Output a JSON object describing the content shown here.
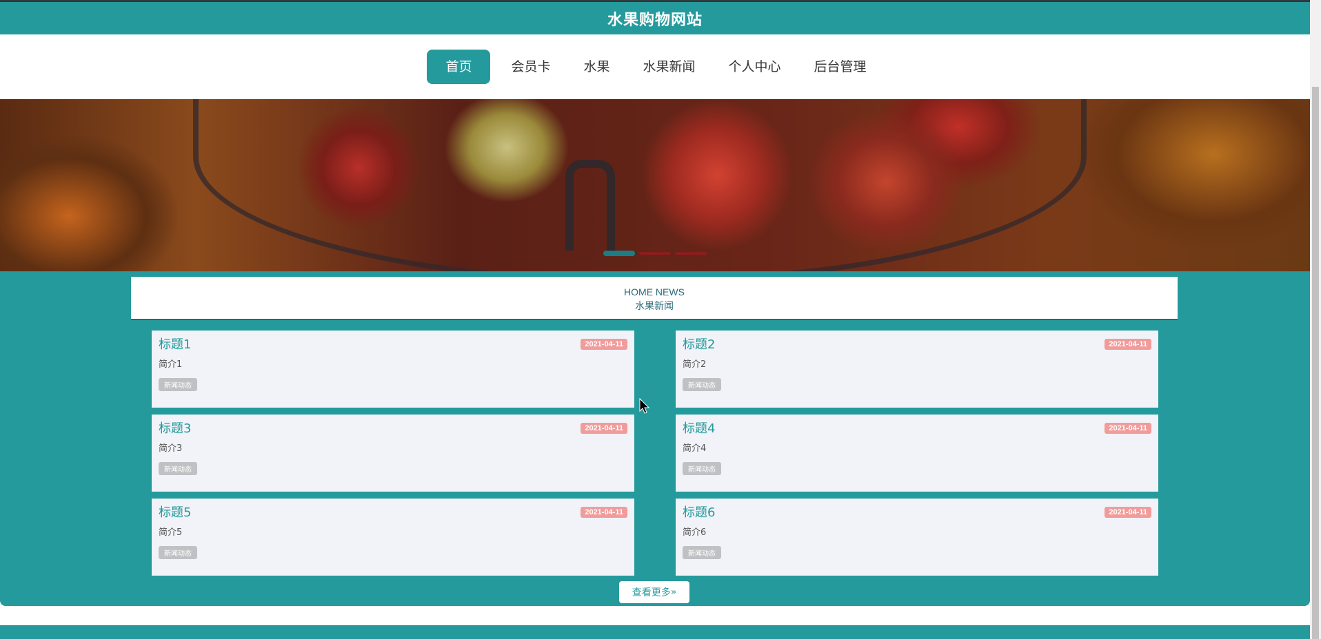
{
  "header": {
    "title": "水果购物网站"
  },
  "nav": {
    "items": [
      {
        "label": "首页"
      },
      {
        "label": "会员卡"
      },
      {
        "label": "水果"
      },
      {
        "label": "水果新闻"
      },
      {
        "label": "个人中心"
      },
      {
        "label": "后台管理"
      }
    ]
  },
  "news": {
    "title_en": "HOME NEWS",
    "title_cn": "水果新闻",
    "items": [
      {
        "title": "标题1",
        "date": "2021-04-11",
        "intro": "简介1",
        "tag": "新闻动态"
      },
      {
        "title": "标题2",
        "date": "2021-04-11",
        "intro": "简介2",
        "tag": "新闻动态"
      },
      {
        "title": "标题3",
        "date": "2021-04-11",
        "intro": "简介3",
        "tag": "新闻动态"
      },
      {
        "title": "标题4",
        "date": "2021-04-11",
        "intro": "简介4",
        "tag": "新闻动态"
      },
      {
        "title": "标题5",
        "date": "2021-04-11",
        "intro": "简介5",
        "tag": "新闻动态"
      },
      {
        "title": "标题6",
        "date": "2021-04-11",
        "intro": "简介6",
        "tag": "新闻动态"
      }
    ],
    "more_label": "查看更多"
  },
  "icons": {
    "more": "double-chevron-right-icon"
  },
  "colors": {
    "primary": "#249a9c",
    "date_badge": "#f29b9b",
    "tag": "#bfc1c4"
  }
}
